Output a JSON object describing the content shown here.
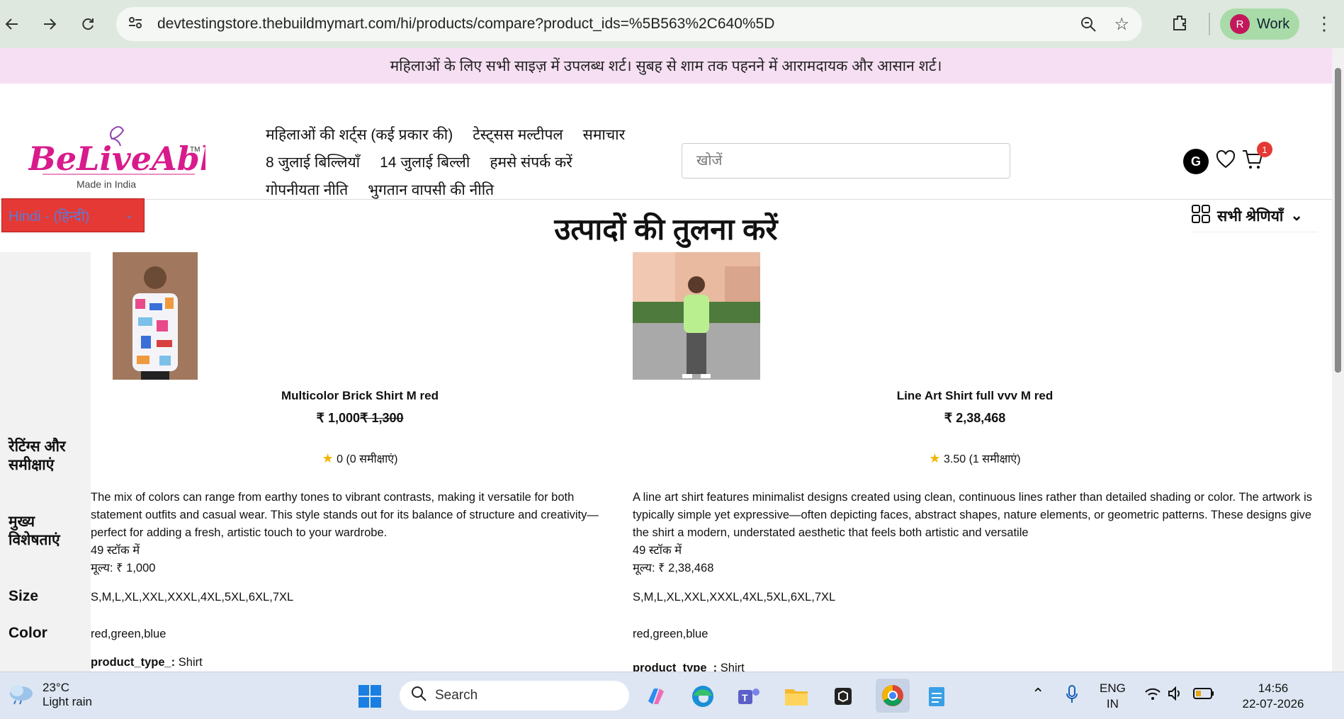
{
  "browser": {
    "url": "devtestingstore.thebuildmymart.com/hi/products/compare?product_ids=%5B563%2C640%5D",
    "profile_initial": "R",
    "profile_label": "Work"
  },
  "announcement": "महिलाओं के लिए सभी साइज़ में उपलब्ध शर्ट। सुबह से शाम तक पहनने में आरामदायक और आसान शर्ट।",
  "logo": {
    "text": "BeLiveAble",
    "tagline": "Made in India"
  },
  "menu": {
    "row1": [
      "महिलाओं की शर्ट्स (कई प्रकार की)",
      "टेस्ट्सस मल्टीपल",
      "समाचार"
    ],
    "row2": [
      "8 जुलाई बिल्लियाँ",
      "14 जुलाई बिल्ली",
      "हमसे संपर्क करें"
    ],
    "row3": [
      "गोपनीयता नीति",
      "भुगतान वापसी की नीति"
    ]
  },
  "search": {
    "placeholder": "खोजें"
  },
  "user_initial": "G",
  "cart_count": "1",
  "language": "Hindi - (हिन्दी)",
  "categories_label": "सभी श्रेणियाँ",
  "page_title": "उत्पादों की तुलना करें",
  "row_labels": {
    "ratings": "रेटिंग्स और समीक्षाएं",
    "features": "मुख्य विशेषताएं",
    "size": "Size",
    "color": "Color"
  },
  "products": [
    {
      "name": "Multicolor Brick Shirt M red",
      "price": "₹ 1,000",
      "old_price": "₹ 1,300",
      "rating": "0 (0 समीक्षाएं)",
      "description": "The mix of colors can range from earthy tones to vibrant contrasts, making it versatile for both statement outfits and casual wear. This style stands out for its balance of structure and creativity—perfect for adding a fresh, artistic touch to your wardrobe.",
      "stock": "49 स्टॉक में",
      "price_line": "मूल्य: ₹ 1,000",
      "sizes": "S,M,L,XL,XXL,XXXL,4XL,5XL,6XL,7XL",
      "colors": "red,green,blue",
      "product_type_label": "product_type_:",
      "product_type_value": "Shirt"
    },
    {
      "name": "Line Art Shirt full vvv M red",
      "price": "₹ 2,38,468",
      "old_price": "",
      "rating": "3.50 (1 समीक्षाएं)",
      "description": "A line art shirt features minimalist designs created using clean, continuous lines rather than detailed shading or color. The artwork is typically simple yet expressive—often depicting faces, abstract shapes, nature elements, or geometric patterns. These designs give the shirt a modern, understated aesthetic that feels both artistic and versatile",
      "stock": "49 स्टॉक में",
      "price_line": "मूल्य: ₹ 2,38,468",
      "sizes": "S,M,L,XL,XXL,XXXL,4XL,5XL,6XL,7XL",
      "colors": "red,green,blue",
      "product_type_label": "product_type_:",
      "product_type_value": "Shirt"
    }
  ],
  "taskbar": {
    "temperature": "23°C",
    "weather": "Light rain",
    "search_placeholder": "Search",
    "lang_top": "ENG",
    "lang_bottom": "IN",
    "time": "14:56",
    "date": "22-07-2026"
  },
  "colors": {
    "accent_red": "#e53935",
    "announce_bg": "#f6dff2",
    "chrome_bg": "#dfe8df"
  }
}
